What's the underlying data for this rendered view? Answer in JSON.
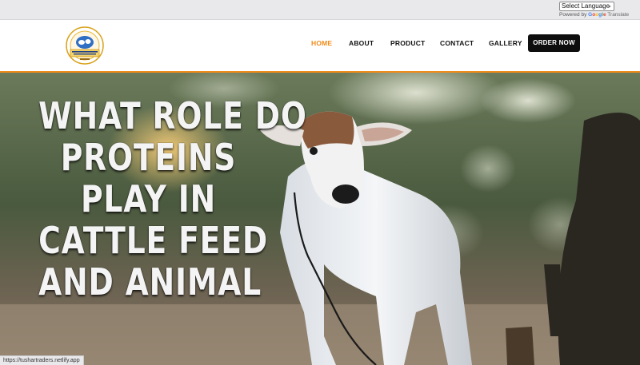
{
  "translate": {
    "select_label": "Select Language",
    "powered_by": "Powered by",
    "google": "Google",
    "translate_word": "Translate"
  },
  "brand": {
    "logo_text_top": "Tushar Traders",
    "logo_text_main": "MAHESH & SIDDHI TRADERS",
    "logo_text_small": "UDGIR"
  },
  "nav": {
    "items": [
      {
        "label": "HOME",
        "active": true
      },
      {
        "label": "ABOUT",
        "active": false
      },
      {
        "label": "PRODUCT",
        "active": false
      },
      {
        "label": "CONTACT",
        "active": false
      },
      {
        "label": "GALLERY",
        "active": false
      }
    ],
    "order_button": "ORDER NOW"
  },
  "hero": {
    "title_lines": [
      "WHAT ROLE DO",
      "PROTEINS",
      "PLAY IN",
      "CATTLE FEED",
      "AND ANIMAL"
    ]
  },
  "status_bar": {
    "url": "https://tushartraders.netlify.app"
  },
  "colors": {
    "accent": "#f08c1a",
    "button_bg": "#0e0e0e"
  }
}
